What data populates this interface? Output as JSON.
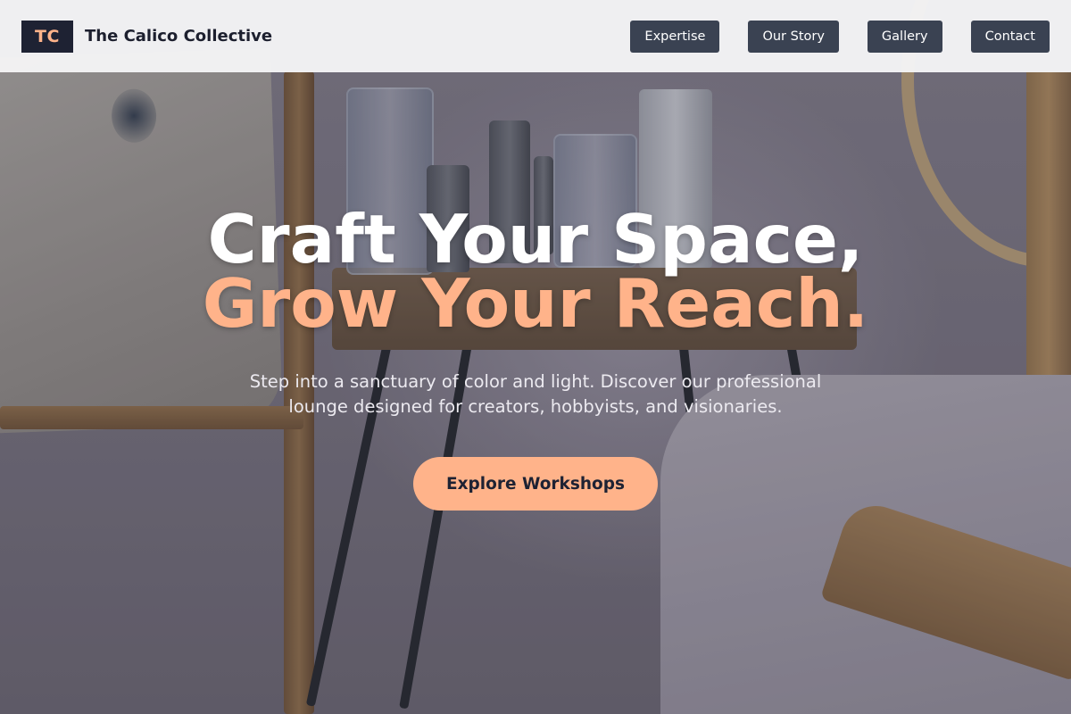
{
  "brand": {
    "logo_text": "TC",
    "name": "The Calico Collective"
  },
  "nav": {
    "items": [
      {
        "label": "Expertise"
      },
      {
        "label": "Our Story"
      },
      {
        "label": "Gallery"
      },
      {
        "label": "Contact"
      }
    ]
  },
  "hero": {
    "headline_line1": "Craft Your Space,",
    "headline_line2": "Grow Your Reach.",
    "subtext": "Step into a sanctuary of color and light. Discover our professional lounge designed for creators, hobbyists, and visionaries.",
    "cta_label": "Explore Workshops"
  },
  "colors": {
    "accent": "#ffb38a",
    "nav_button": "#3a4252",
    "logo_bg": "#1e2233",
    "header_bg": "#f4f4f5"
  }
}
